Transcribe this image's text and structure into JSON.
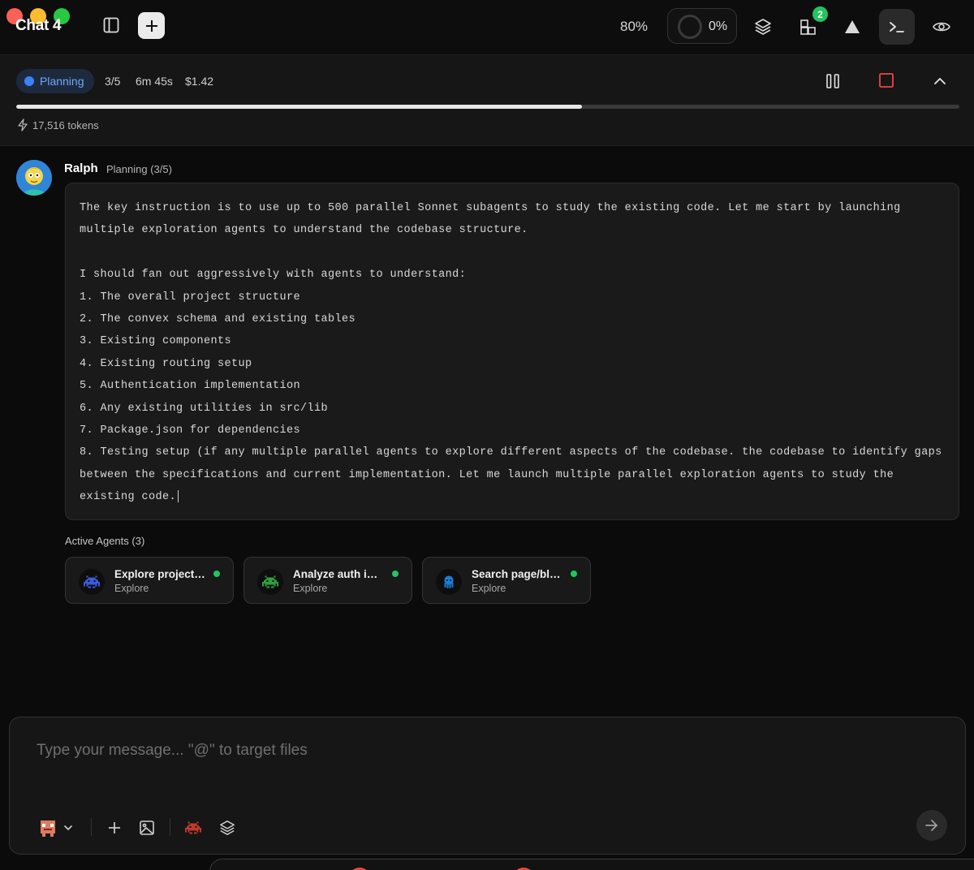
{
  "window": {
    "title": "Chat 4"
  },
  "topbar": {
    "zoom": "80%",
    "context_usage": "0%",
    "widgets_badge": "2"
  },
  "status": {
    "phase": "Planning",
    "step": "3/5",
    "elapsed": "6m 45s",
    "cost": "$1.42",
    "progress": 0.6,
    "tokens": "17,516 tokens"
  },
  "message": {
    "author": "Ralph",
    "phase_label": "Planning (3/5)",
    "text": "The key instruction is to use up to 500 parallel Sonnet subagents to study the existing code. Let me start by launching\nmultiple exploration agents to understand the codebase structure.\n\nI should fan out aggressively with agents to understand:\n1. The overall project structure\n2. The convex schema and existing tables\n3. Existing components\n4. Existing routing setup\n5. Authentication implementation\n6. Any existing utilities in src/lib\n7. Package.json for dependencies\n8. Testing setup (if any multiple parallel agents to explore different aspects of the codebase. the codebase to identify gaps\nbetween the specifications and current implementation. Let me launch multiple parallel exploration agents to study the\nexisting code."
  },
  "agents": {
    "title": "Active Agents (3)",
    "items": [
      {
        "name": "Explore project s...",
        "type": "Explore",
        "icon": "space-invader-icon",
        "color": "#3b5bdb"
      },
      {
        "name": "Analyze auth imp...",
        "type": "Explore",
        "icon": "space-invader-icon",
        "color": "#2f9e44"
      },
      {
        "name": "Search page/blo...",
        "type": "Explore",
        "icon": "octopus-icon",
        "color": "#1c7ed6"
      }
    ]
  },
  "composer": {
    "placeholder": "Type your message... \"@\" to target files"
  },
  "colors": {
    "accent_blue": "#3b82f6",
    "status_green": "#22c55e",
    "stop_red": "#ef4444"
  }
}
